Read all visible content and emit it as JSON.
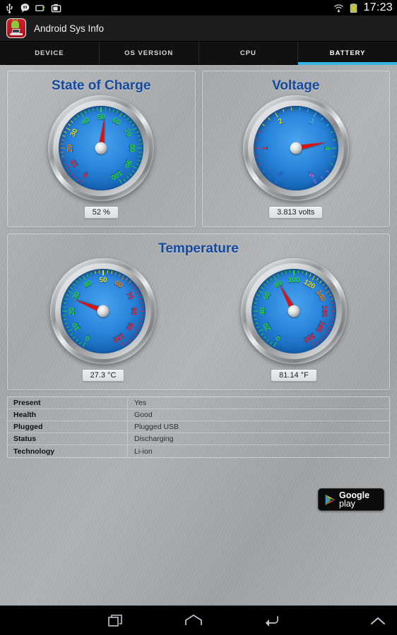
{
  "statusbar": {
    "icons": [
      "usb-icon",
      "hangouts-icon",
      "usb-connected-icon",
      "screenshot-icon"
    ],
    "wifi_icon": "wifi-icon",
    "battery_icon": "battery-charging-icon",
    "time": "17:23"
  },
  "actionbar": {
    "app_icon": "android-sys-info-icon",
    "title": "Android Sys Info"
  },
  "tabs": [
    {
      "label": "DEVICE",
      "active": false
    },
    {
      "label": "OS VERSION",
      "active": false
    },
    {
      "label": "CPU",
      "active": false
    },
    {
      "label": "BATTERY",
      "active": true
    }
  ],
  "accent_color": "#33b5e5",
  "title_color": "#14499f",
  "needle_color": "#dd1111",
  "panels": [
    {
      "id": "state-of-charge",
      "title": "State of Charge",
      "gauges": [
        {
          "name": "state-of-charge-gauge",
          "readout": "52 %",
          "value": 52,
          "min": 0,
          "max": 100,
          "labels": [
            {
              "text": "0",
              "value": 0,
              "color": "#e8243c"
            },
            {
              "text": "10",
              "value": 10,
              "color": "#e8243c"
            },
            {
              "text": "20",
              "value": 20,
              "color": "#e8801c"
            },
            {
              "text": "30",
              "value": 30,
              "color": "#e8dc1c"
            },
            {
              "text": "40",
              "value": 40,
              "color": "#28d838"
            },
            {
              "text": "50",
              "value": 50,
              "color": "#28d838"
            },
            {
              "text": "60",
              "value": 60,
              "color": "#28d838"
            },
            {
              "text": "70",
              "value": 70,
              "color": "#28d838"
            },
            {
              "text": "80",
              "value": 80,
              "color": "#28d838"
            },
            {
              "text": "90",
              "value": 90,
              "color": "#28d838"
            },
            {
              "text": "100",
              "value": 100,
              "color": "#28d838"
            }
          ]
        }
      ]
    },
    {
      "id": "voltage",
      "title": "Voltage",
      "gauges": [
        {
          "name": "voltage-gauge",
          "readout": "3.813 volts",
          "value": 3.813,
          "min": 0,
          "max": 5,
          "labels": [
            {
              "text": "0",
              "value": 0,
              "color": "#2f6ee0"
            },
            {
              "text": "1",
              "value": 1,
              "color": "#e8243c"
            },
            {
              "text": "2",
              "value": 2,
              "color": "#e8dc1c"
            },
            {
              "text": "3",
              "value": 3,
              "color": "#3ec6f0"
            },
            {
              "text": "4",
              "value": 4,
              "color": "#28d838"
            },
            {
              "text": "5",
              "value": 5,
              "color": "#e060e0"
            }
          ]
        }
      ]
    },
    {
      "id": "temperature",
      "title": "Temperature",
      "gauges": [
        {
          "name": "temperature-celsius-gauge",
          "readout": "27.3 °C",
          "value": 27.3,
          "min": 0,
          "max": 100,
          "labels": [
            {
              "text": "0",
              "value": 0,
              "color": "#28d838"
            },
            {
              "text": "10",
              "value": 10,
              "color": "#28d838"
            },
            {
              "text": "20",
              "value": 20,
              "color": "#28d838"
            },
            {
              "text": "30",
              "value": 30,
              "color": "#28d838"
            },
            {
              "text": "40",
              "value": 40,
              "color": "#28d838"
            },
            {
              "text": "50",
              "value": 50,
              "color": "#e8dc1c"
            },
            {
              "text": "60",
              "value": 60,
              "color": "#e8801c"
            },
            {
              "text": "70",
              "value": 70,
              "color": "#e8243c"
            },
            {
              "text": "80",
              "value": 80,
              "color": "#e8243c"
            },
            {
              "text": "90",
              "value": 90,
              "color": "#e8243c"
            },
            {
              "text": "100",
              "value": 100,
              "color": "#e8243c"
            }
          ]
        },
        {
          "name": "temperature-fahrenheit-gauge",
          "readout": "81.14 °F",
          "value": 81.14,
          "min": 0,
          "max": 200,
          "labels": [
            {
              "text": "0",
              "value": 0,
              "color": "#28d838"
            },
            {
              "text": "20",
              "value": 20,
              "color": "#28d838"
            },
            {
              "text": "40",
              "value": 40,
              "color": "#28d838"
            },
            {
              "text": "60",
              "value": 60,
              "color": "#28d838"
            },
            {
              "text": "80",
              "value": 80,
              "color": "#28d838"
            },
            {
              "text": "100",
              "value": 100,
              "color": "#28d838"
            },
            {
              "text": "120",
              "value": 120,
              "color": "#e8dc1c"
            },
            {
              "text": "140",
              "value": 140,
              "color": "#e8801c"
            },
            {
              "text": "160",
              "value": 160,
              "color": "#e8243c"
            },
            {
              "text": "180",
              "value": 180,
              "color": "#e8243c"
            },
            {
              "text": "200",
              "value": 200,
              "color": "#e8243c"
            }
          ]
        }
      ]
    }
  ],
  "info_table": [
    {
      "key": "Present",
      "value": "Yes"
    },
    {
      "key": "Health",
      "value": "Good"
    },
    {
      "key": "Plugged",
      "value": "Plugged USB"
    },
    {
      "key": "Status",
      "value": "Discharging"
    },
    {
      "key": "Technology",
      "value": "Li-ion"
    }
  ],
  "play_badge": {
    "icon": "google-play-icon",
    "brand": "Google",
    "product": "play"
  },
  "navbar": [
    {
      "name": "recent-apps-button",
      "icon": "recent-apps-icon"
    },
    {
      "name": "home-button",
      "icon": "home-icon"
    },
    {
      "name": "back-button",
      "icon": "back-icon"
    },
    {
      "name": "expand-button",
      "icon": "chevron-up-icon"
    }
  ]
}
